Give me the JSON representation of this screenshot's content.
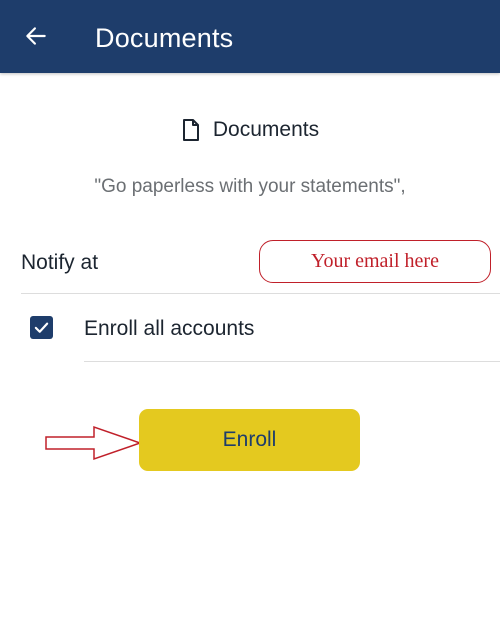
{
  "header": {
    "title": "Documents",
    "back_icon": "arrow-left-icon",
    "background_color": "#1e3d6b"
  },
  "section": {
    "icon": "document-icon",
    "title": "Documents",
    "subtitle": "\"Go paperless with your statements\","
  },
  "notify": {
    "label": "Notify at",
    "email_value": "Your email here"
  },
  "enroll_all": {
    "label": "Enroll all accounts",
    "checked": true
  },
  "enroll_button": {
    "label": "Enroll",
    "color": "#e4c91f"
  },
  "annotation": {
    "arrow_icon": "pointer-arrow-icon",
    "color": "#c0202a"
  }
}
